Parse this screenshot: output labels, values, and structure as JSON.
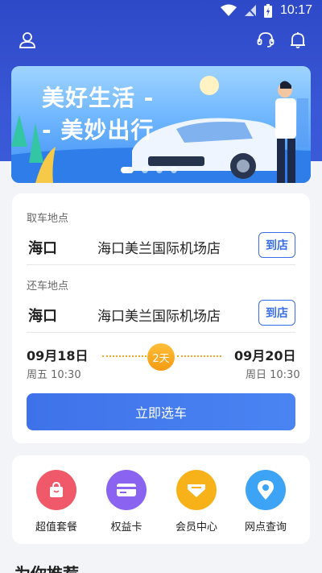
{
  "status_bar": {
    "time": "10:17"
  },
  "nav": {
    "user_icon": "user-icon",
    "service_icon": "headset-icon",
    "bell_icon": "bell-icon"
  },
  "banner": {
    "line1": "美好生活 -",
    "line2": "- 美妙出行",
    "slides": 4,
    "active_slide": 1
  },
  "pickup": {
    "label": "取车地点",
    "city": "海口",
    "store": "海口美兰国际机场店",
    "button": "到店"
  },
  "return": {
    "label": "还车地点",
    "city": "海口",
    "store": "海口美兰国际机场店",
    "button": "到店"
  },
  "dates": {
    "start_date": "09月18日",
    "start_weekday": "周五 10:30",
    "end_date": "09月20日",
    "end_weekday": "周日 10:30",
    "duration": "2天"
  },
  "primary_button": "立即选车",
  "menu": [
    {
      "label": "超值套餐",
      "icon": "gift-bag-icon",
      "color": "#f0596a"
    },
    {
      "label": "权益卡",
      "icon": "card-icon",
      "color": "#8a63f0"
    },
    {
      "label": "会员中心",
      "icon": "vip-icon",
      "color": "#f7b21a"
    },
    {
      "label": "网点查询",
      "icon": "location-icon",
      "color": "#3da3f5"
    }
  ],
  "recommend_title": "为你推荐",
  "colors": {
    "header": "#3352cf",
    "accent": "#3a6ee8",
    "badge": "#f5a623"
  }
}
